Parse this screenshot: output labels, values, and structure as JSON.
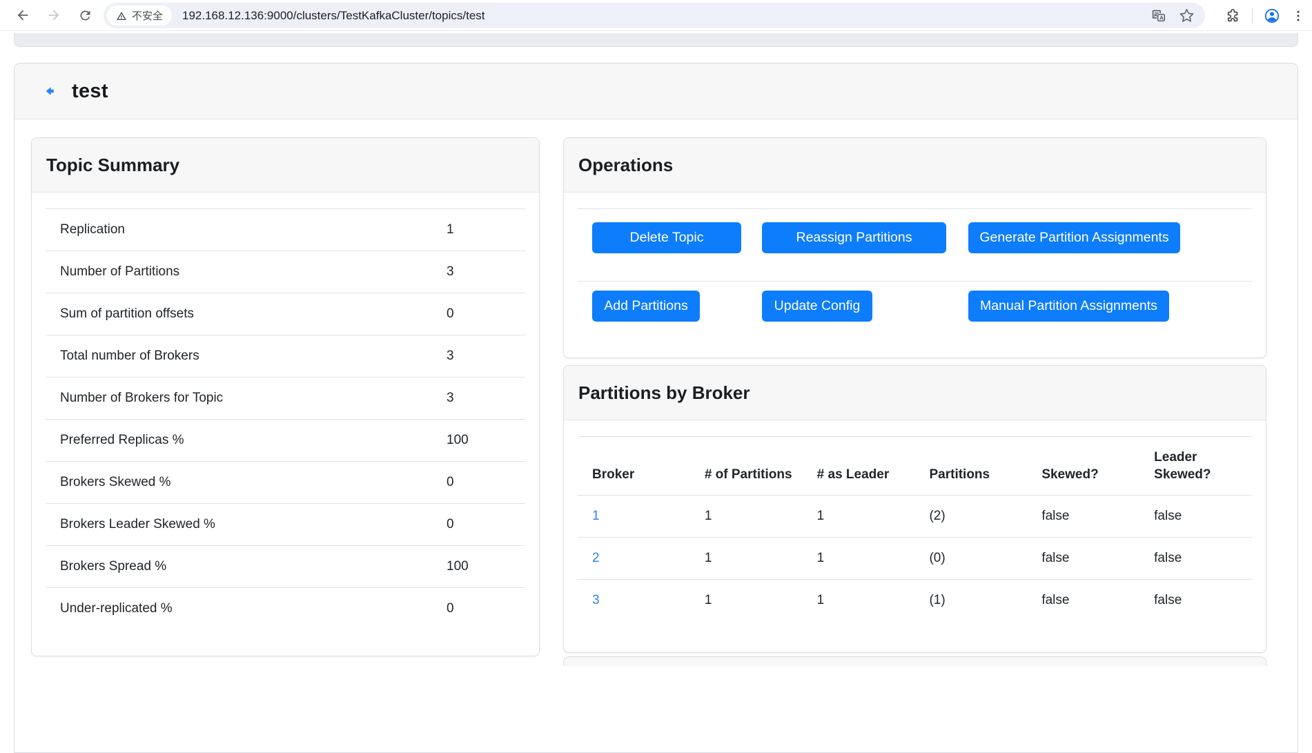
{
  "browser": {
    "security_label": "不安全",
    "url": "192.168.12.136:9000/clusters/TestKafkaCluster/topics/test"
  },
  "page": {
    "title": "test"
  },
  "topic_summary": {
    "title": "Topic Summary",
    "rows": [
      {
        "label": "Replication",
        "value": "1"
      },
      {
        "label": "Number of Partitions",
        "value": "3"
      },
      {
        "label": "Sum of partition offsets",
        "value": "0"
      },
      {
        "label": "Total number of Brokers",
        "value": "3"
      },
      {
        "label": "Number of Brokers for Topic",
        "value": "3"
      },
      {
        "label": "Preferred Replicas %",
        "value": "100"
      },
      {
        "label": "Brokers Skewed %",
        "value": "0"
      },
      {
        "label": "Brokers Leader Skewed %",
        "value": "0"
      },
      {
        "label": "Brokers Spread %",
        "value": "100"
      },
      {
        "label": "Under-replicated %",
        "value": "0"
      }
    ]
  },
  "operations": {
    "title": "Operations",
    "row1": [
      "Delete Topic",
      "Reassign Partitions",
      "Generate Partition Assignments"
    ],
    "row2": [
      "Add Partitions",
      "Update Config",
      "Manual Partition Assignments"
    ]
  },
  "partitions_by_broker": {
    "title": "Partitions by Broker",
    "columns": [
      "Broker",
      "# of Partitions",
      "# as Leader",
      "Partitions",
      "Skewed?",
      "Leader\nSkewed?"
    ],
    "rows": [
      [
        "1",
        "1",
        "1",
        "(2)",
        "false",
        "false"
      ],
      [
        "2",
        "1",
        "1",
        "(0)",
        "false",
        "false"
      ],
      [
        "3",
        "1",
        "1",
        "(1)",
        "false",
        "false"
      ]
    ]
  },
  "colors": {
    "accent": "#0d7dfb",
    "link": "#2e82f2",
    "card_header_bg": "#f7f7f7"
  }
}
